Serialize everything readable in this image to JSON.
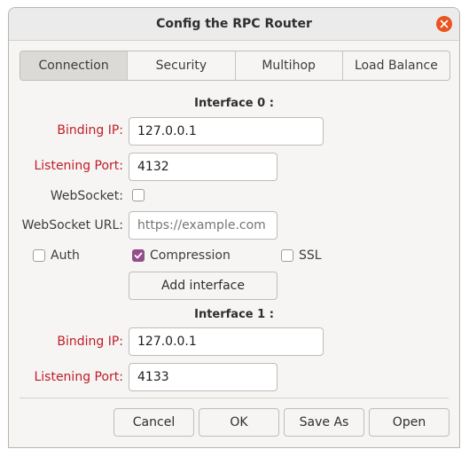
{
  "window": {
    "title": "Config the RPC Router"
  },
  "tabs": [
    "Connection",
    "Security",
    "Multihop",
    "Load Balance"
  ],
  "interface0": {
    "heading": "Interface 0 :",
    "binding_ip_label": "Binding IP:",
    "binding_ip_value": "127.0.0.1",
    "listening_port_label": "Listening Port:",
    "listening_port_value": "4132",
    "websocket_label": "WebSocket:",
    "websocket_checked": false,
    "websocket_url_label": "WebSocket URL:",
    "websocket_url_placeholder": "https://example.com",
    "auth_label": "Auth",
    "compression_label": "Compression",
    "compression_checked": true,
    "ssl_label": "SSL",
    "add_interface_label": "Add interface"
  },
  "interface1": {
    "heading": "Interface 1 :",
    "binding_ip_label": "Binding IP:",
    "binding_ip_value": "127.0.0.1",
    "listening_port_label": "Listening Port:",
    "listening_port_value": "4133"
  },
  "footer": {
    "cancel": "Cancel",
    "ok": "OK",
    "save_as": "Save As",
    "open": "Open"
  },
  "colors": {
    "required_label": "#c01c28",
    "accent": "#924d8b",
    "close_button": "#e95420"
  }
}
